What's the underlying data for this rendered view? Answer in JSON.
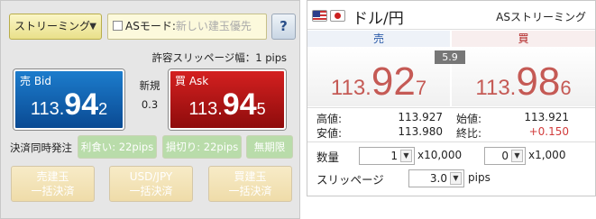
{
  "left": {
    "streaming_label": "ストリーミング",
    "dropdown_caret": "▼",
    "as_mode_label": "ASモード:",
    "as_mode_placeholder": "新しい建玉優先",
    "help_label": "?",
    "slippage_text": "許容スリッページ幅：1 pips",
    "bid": {
      "label": "売 Bid",
      "p1": "113.",
      "p2": "94",
      "p3": "2"
    },
    "ask": {
      "label": "買 Ask",
      "p1": "113.",
      "p2": "94",
      "p3": "5"
    },
    "new_label": "新規",
    "spread": "0.3",
    "settle_label": "決済同時発注",
    "take_profit": "利食い: 22pips",
    "stop_loss": "損切り: 22pips",
    "unlimited": "無期限",
    "bulk_sell_line1": "売建玉",
    "bulk_sell_line2": "一括決済",
    "bulk_pair_line1": "USD/JPY",
    "bulk_pair_line2": "一括決済",
    "bulk_buy_line1": "買建玉",
    "bulk_buy_line2": "一括決済"
  },
  "right": {
    "pair": "ドル/円",
    "mode": "ASストリーミング",
    "sell_header": "売",
    "buy_header": "買",
    "spread": "5.9",
    "sell_price": {
      "p1": "113.",
      "p2": "92",
      "p3": "7"
    },
    "buy_price": {
      "p1": "113.",
      "p2": "98",
      "p3": "6"
    },
    "stats": {
      "high_label": "高値:",
      "high": "113.927",
      "low_label": "安値:",
      "low": "113.980",
      "open_label": "始値:",
      "open": "113.921",
      "close_label": "終比:",
      "close": "+0.150"
    },
    "qty_label": "数量",
    "qty1_value": "1",
    "qty1_unit": "x10,000",
    "qty2_value": "0",
    "qty2_unit": "x1,000",
    "slip_label": "スリッページ",
    "slip_value": "3.0",
    "slip_unit": "pips"
  },
  "colors": {
    "bid": "#0a4a93",
    "ask": "#8e0c0c",
    "price_red": "#c55a55",
    "positive": "#d23c3c"
  }
}
